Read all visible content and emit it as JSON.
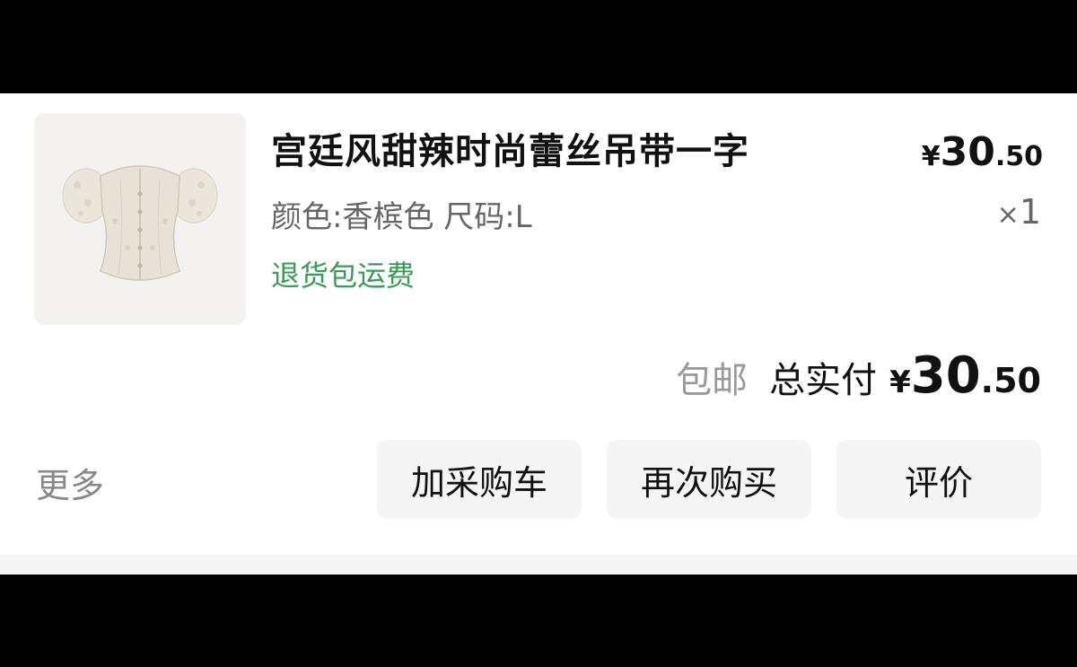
{
  "item": {
    "title": "宫廷风甜辣时尚蕾丝吊带一字",
    "spec": "颜色:香槟色 尺码:L",
    "return_tag": "退货包运费",
    "unit_price": {
      "currency": "¥",
      "integer": "30",
      "decimal": ".50"
    },
    "quantity": {
      "prefix": "×",
      "value": "1"
    },
    "image_icon": "champagne-lace-corset-top"
  },
  "total": {
    "shipping": "包邮",
    "label": "总实付",
    "currency": "¥",
    "integer": "30",
    "decimal": ".50"
  },
  "actions": {
    "more": "更多",
    "add_cart": "加采购车",
    "rebuy": "再次购买",
    "review": "评价"
  },
  "colors": {
    "accent_green": "#3a9a57",
    "button_bg": "#f5f5f5",
    "muted_text": "#999999"
  }
}
